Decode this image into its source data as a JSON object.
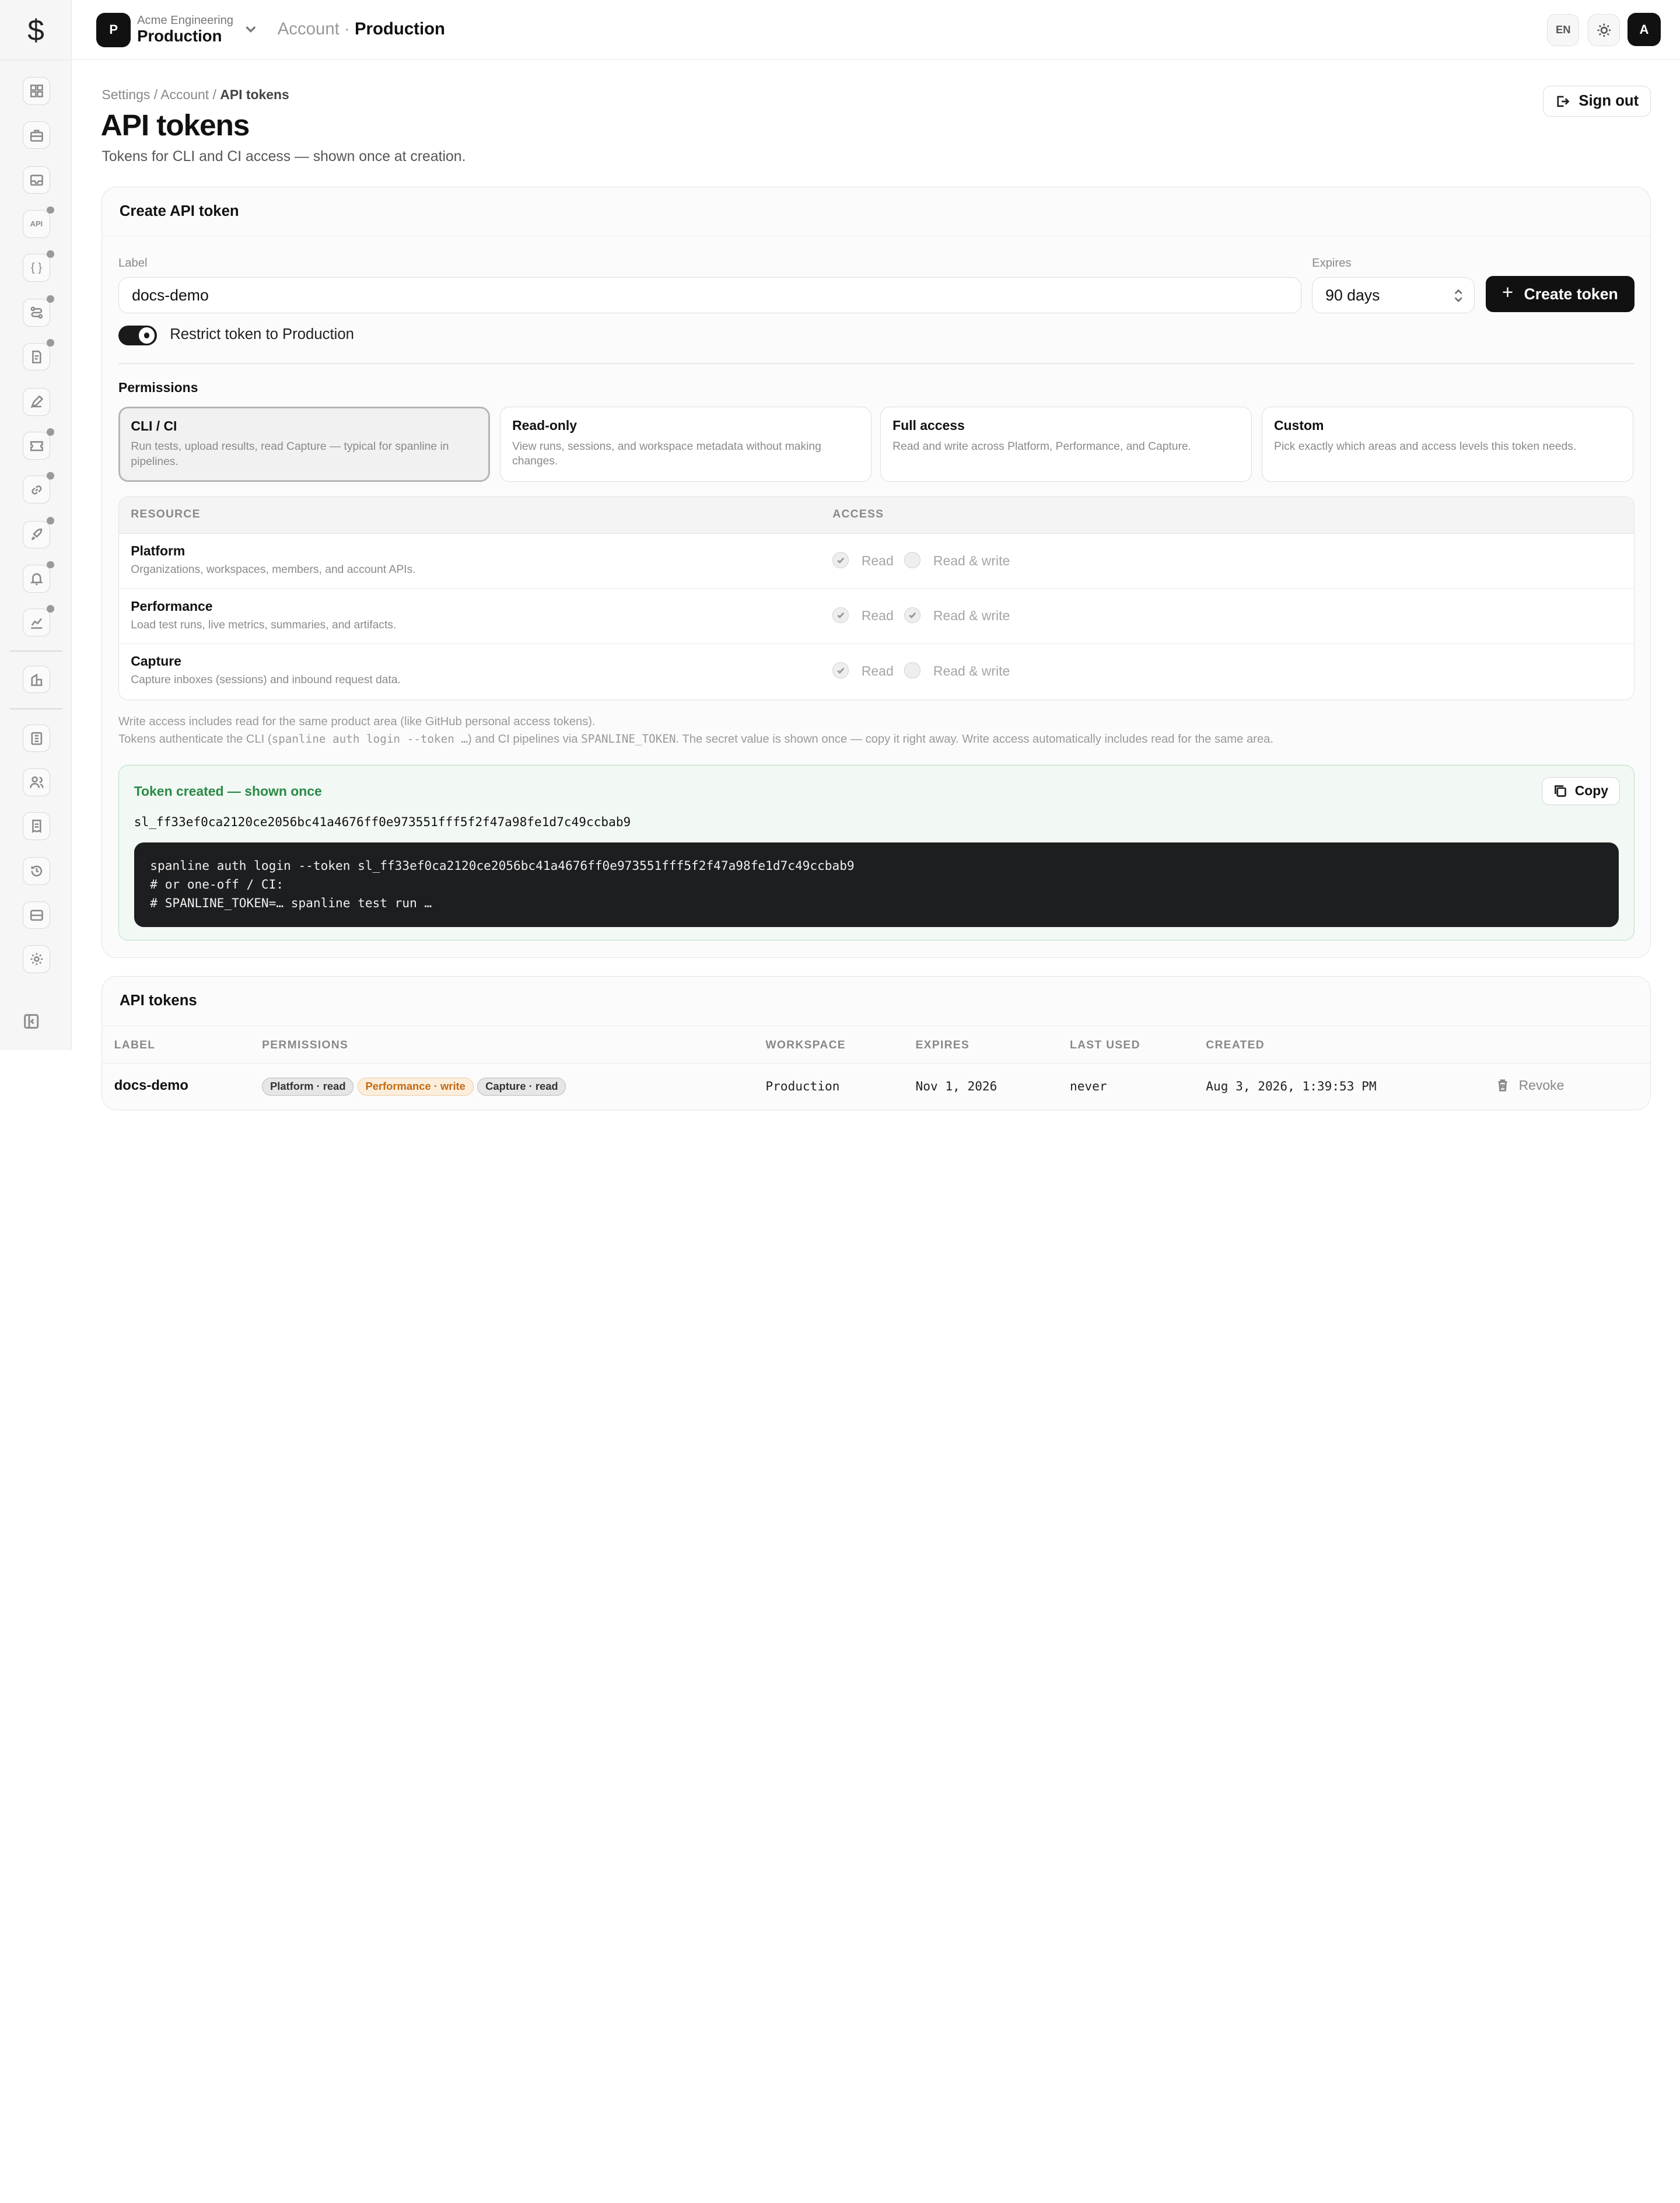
{
  "app": {
    "logo_symbol": "$"
  },
  "topbar": {
    "workspace_initial": "P",
    "org_name": "Acme Engineering",
    "workspace_name": "Production",
    "breadcrumb_section": "Account",
    "breadcrumb_sep": "·",
    "breadcrumb_current": "Production",
    "language": "EN",
    "avatar_initial": "A"
  },
  "sidebar": {
    "items": [
      {
        "icon": "dashboard-icon",
        "dot": false
      },
      {
        "icon": "briefcase-icon",
        "dot": false
      },
      {
        "icon": "inbox-icon",
        "dot": false
      },
      {
        "icon": "api-icon",
        "label": "API",
        "dot": true
      },
      {
        "icon": "code-braces-icon",
        "label": "{ }",
        "dot": true
      },
      {
        "icon": "route-icon",
        "dot": true
      },
      {
        "icon": "report-icon",
        "dot": true
      },
      {
        "icon": "pen-icon",
        "dot": false
      },
      {
        "icon": "ticket-icon",
        "dot": true
      },
      {
        "icon": "link-icon",
        "dot": true
      },
      {
        "icon": "rocket-icon",
        "dot": true
      },
      {
        "icon": "bell-icon",
        "dot": true
      },
      {
        "icon": "chart-icon",
        "dot": true
      },
      {
        "icon": "building-icon",
        "dot": false
      },
      {
        "icon": "ledger-icon",
        "dot": false
      },
      {
        "icon": "users-icon",
        "dot": false
      },
      {
        "icon": "receipt-icon",
        "dot": false
      },
      {
        "icon": "history-icon",
        "dot": false
      },
      {
        "icon": "storage-icon",
        "dot": false
      },
      {
        "icon": "gear-icon",
        "dot": false
      }
    ]
  },
  "page": {
    "breadcrumb": {
      "root": "Settings",
      "middle": "Account",
      "current": "API tokens",
      "sep": "/"
    },
    "title": "API tokens",
    "subtitle": "Tokens for CLI and CI access — shown once at creation.",
    "sign_out": "Sign out"
  },
  "create": {
    "title": "Create API token",
    "label_caption": "Label",
    "label_value": "docs-demo",
    "expires_caption": "Expires",
    "expires_value": "90 days",
    "create_button": "Create token",
    "restrict_toggle_on": true,
    "restrict_label": "Restrict token to Production",
    "permissions_title": "Permissions",
    "presets": [
      {
        "title": "CLI / CI",
        "desc": "Run tests, upload results, read Capture — typical for spanline in pipelines.",
        "selected": true
      },
      {
        "title": "Read-only",
        "desc": "View runs, sessions, and workspace metadata without making changes.",
        "selected": false
      },
      {
        "title": "Full access",
        "desc": "Read and write across Platform, Performance, and Capture.",
        "selected": false
      },
      {
        "title": "Custom",
        "desc": "Pick exactly which areas and access levels this token needs.",
        "selected": false
      }
    ],
    "resource_header": "RESOURCE",
    "access_header": "ACCESS",
    "read_label": "Read",
    "readwrite_label": "Read & write",
    "resources": [
      {
        "name": "Platform",
        "desc": "Organizations, workspaces, members, and account APIs.",
        "read": true,
        "write": false
      },
      {
        "name": "Performance",
        "desc": "Load test runs, live metrics, summaries, and artifacts.",
        "read": true,
        "write": true
      },
      {
        "name": "Capture",
        "desc": "Capture inboxes (sessions) and inbound request data.",
        "read": true,
        "write": false
      }
    ],
    "note_1": "Write access includes read for the same product area (like GitHub personal access tokens).",
    "note_2_a": "Tokens authenticate the CLI (",
    "note_2_code_a": "spanline auth login --token …",
    "note_2_b": ") and CI pipelines via ",
    "note_2_code_b": "SPANLINE_TOKEN",
    "note_2_c": ". The secret value is shown once — copy it right away. Write access automatically includes read for the same area.",
    "created_title": "Token created — shown once",
    "copy_button": "Copy",
    "token_value": "sl_ff33ef0ca2120ce2056bc41a4676ff0e973551fff5f2f47a98fe1d7c49ccbab9",
    "code_lines": [
      "spanline auth login --token sl_ff33ef0ca2120ce2056bc41a4676ff0e973551fff5f2f47a98fe1d7c49ccbab9",
      "# or one-off / CI:",
      "# SPANLINE_TOKEN=… spanline test run …"
    ]
  },
  "tokens": {
    "title": "API tokens",
    "headers": {
      "label": "LABEL",
      "permissions": "PERMISSIONS",
      "workspace": "WORKSPACE",
      "expires": "EXPIRES",
      "last_used": "LAST USED",
      "created": "CREATED"
    },
    "rows": [
      {
        "label": "docs-demo",
        "permissions": [
          {
            "text": "Platform · read",
            "tone": "gray"
          },
          {
            "text": "Performance · write",
            "tone": "orange"
          },
          {
            "text": "Capture · read",
            "tone": "gray"
          }
        ],
        "workspace": "Production",
        "expires": "Nov 1, 2026",
        "last_used": "never",
        "created": "Aug 3, 2026, 1:39:53 PM",
        "revoke": "Revoke"
      }
    ]
  }
}
